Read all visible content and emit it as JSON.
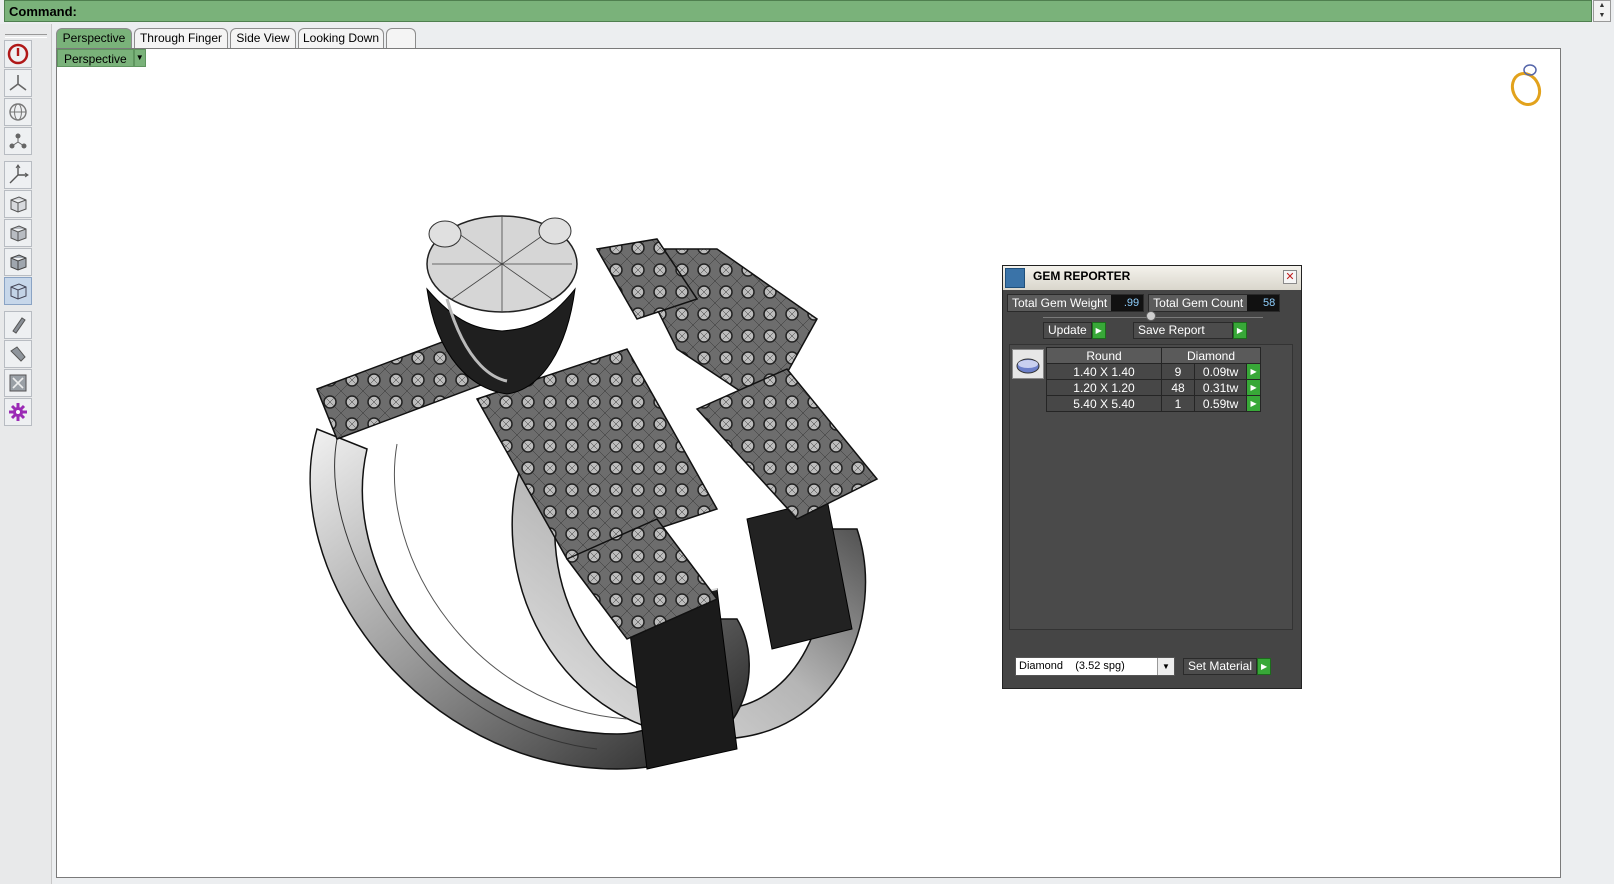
{
  "command_bar": {
    "label": "Command:"
  },
  "toolbar": {
    "buttons": [
      "power-icon",
      "view-icon",
      "globe-icon",
      "node-icon",
      "axes-icon",
      "cube-icon",
      "cube-shaded-icon",
      "cube-wire-icon",
      "cube-selected-icon",
      "pencil-icon",
      "tool-icon",
      "frame-icon",
      "gear-icon"
    ]
  },
  "tabs": [
    "Perspective",
    "Through Finger",
    "Side View",
    "Looking Down",
    ""
  ],
  "viewport": {
    "dropdown_label": "Perspective"
  },
  "gem_reporter": {
    "title": "GEM REPORTER",
    "total_weight_label": "Total Gem Weight",
    "total_weight_value": ".99",
    "total_count_label": "Total Gem Count",
    "total_count_value": "58",
    "update_label": "Update",
    "save_report_label": "Save Report",
    "table": {
      "headers": [
        "Round",
        "Diamond"
      ],
      "rows": [
        {
          "size": "1.40 X 1.40",
          "count": "9",
          "weight": "0.09tw"
        },
        {
          "size": "1.20 X 1.20",
          "count": "48",
          "weight": "0.31tw"
        },
        {
          "size": "5.40 X 5.40",
          "count": "1",
          "weight": "0.59tw"
        }
      ]
    },
    "material_value": "Diamond    (3.52 spg)",
    "set_material_label": "Set Material"
  }
}
